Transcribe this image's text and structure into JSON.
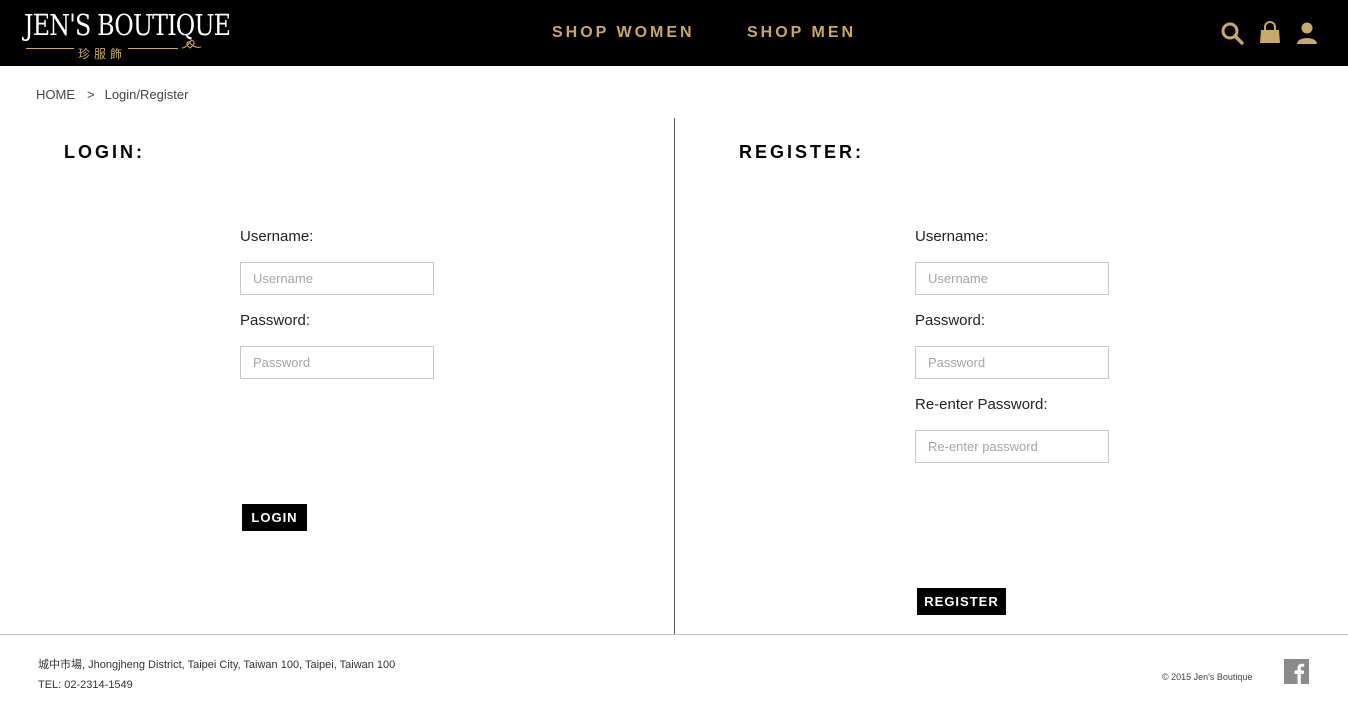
{
  "header": {
    "logo_main": "JEN'S BOUTIQUE",
    "logo_sub": "珍服飾",
    "nav": [
      {
        "label": "SHOP WOMEN"
      },
      {
        "label": "SHOP MEN"
      }
    ],
    "icons": [
      "search-icon",
      "shopping-bag-icon",
      "user-icon"
    ],
    "background": "#000000",
    "accent": "#c9a86b"
  },
  "breadcrumb": {
    "home": "HOME",
    "separator": ">",
    "current": "Login/Register"
  },
  "login": {
    "title": "LOGIN:",
    "username_label": "Username:",
    "username_placeholder": "Username",
    "password_label": "Password:",
    "password_placeholder": "Password",
    "button": "LOGIN"
  },
  "register": {
    "title": "REGISTER:",
    "username_label": "Username:",
    "username_placeholder": "Username",
    "password_label": "Password:",
    "password_placeholder": "Password",
    "reenter_label": "Re-enter Password:",
    "reenter_placeholder": "Re-enter password",
    "button": "REGISTER"
  },
  "footer": {
    "address": "城中市場, Jhongjheng District, Taipei City, Taiwan 100, Taipei, Taiwan 100",
    "tel": "TEL: 02-2314-1549",
    "copyright": "© 2015 Jen's Boutique",
    "social_icon": "facebook-icon"
  }
}
